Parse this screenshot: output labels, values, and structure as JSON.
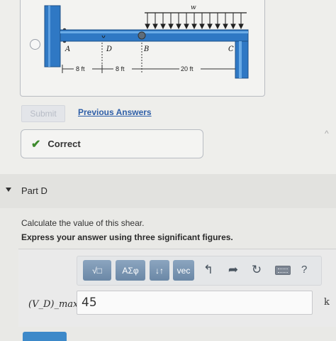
{
  "figure": {
    "load_label": "w",
    "point_labels": [
      "A",
      "D",
      "B",
      "C"
    ],
    "dimensions": [
      "8 ft",
      "8 ft",
      "20 ft"
    ]
  },
  "actions": {
    "submit_label": "Submit",
    "previous_answers_label": "Previous Answers"
  },
  "feedback": {
    "status_text": "Correct"
  },
  "part": {
    "title": "Part D",
    "question": "Calculate the value of this shear.",
    "instruction": "Express your answer using three significant figures."
  },
  "toolbar": {
    "buttons": [
      "√□",
      "AΣφ",
      "↓↑",
      "vec"
    ],
    "icons": [
      "undo-icon",
      "redo-icon",
      "reset-icon",
      "keyboard-icon",
      "help-icon"
    ],
    "help_label": "?"
  },
  "answer": {
    "label": "(V_D)_max =",
    "value": "45",
    "unit": "k"
  },
  "colors": {
    "beam": "#2f78c4",
    "link": "#2f5fa8",
    "check": "#3d8a2c",
    "toolbar_button": "#7b97b4"
  }
}
